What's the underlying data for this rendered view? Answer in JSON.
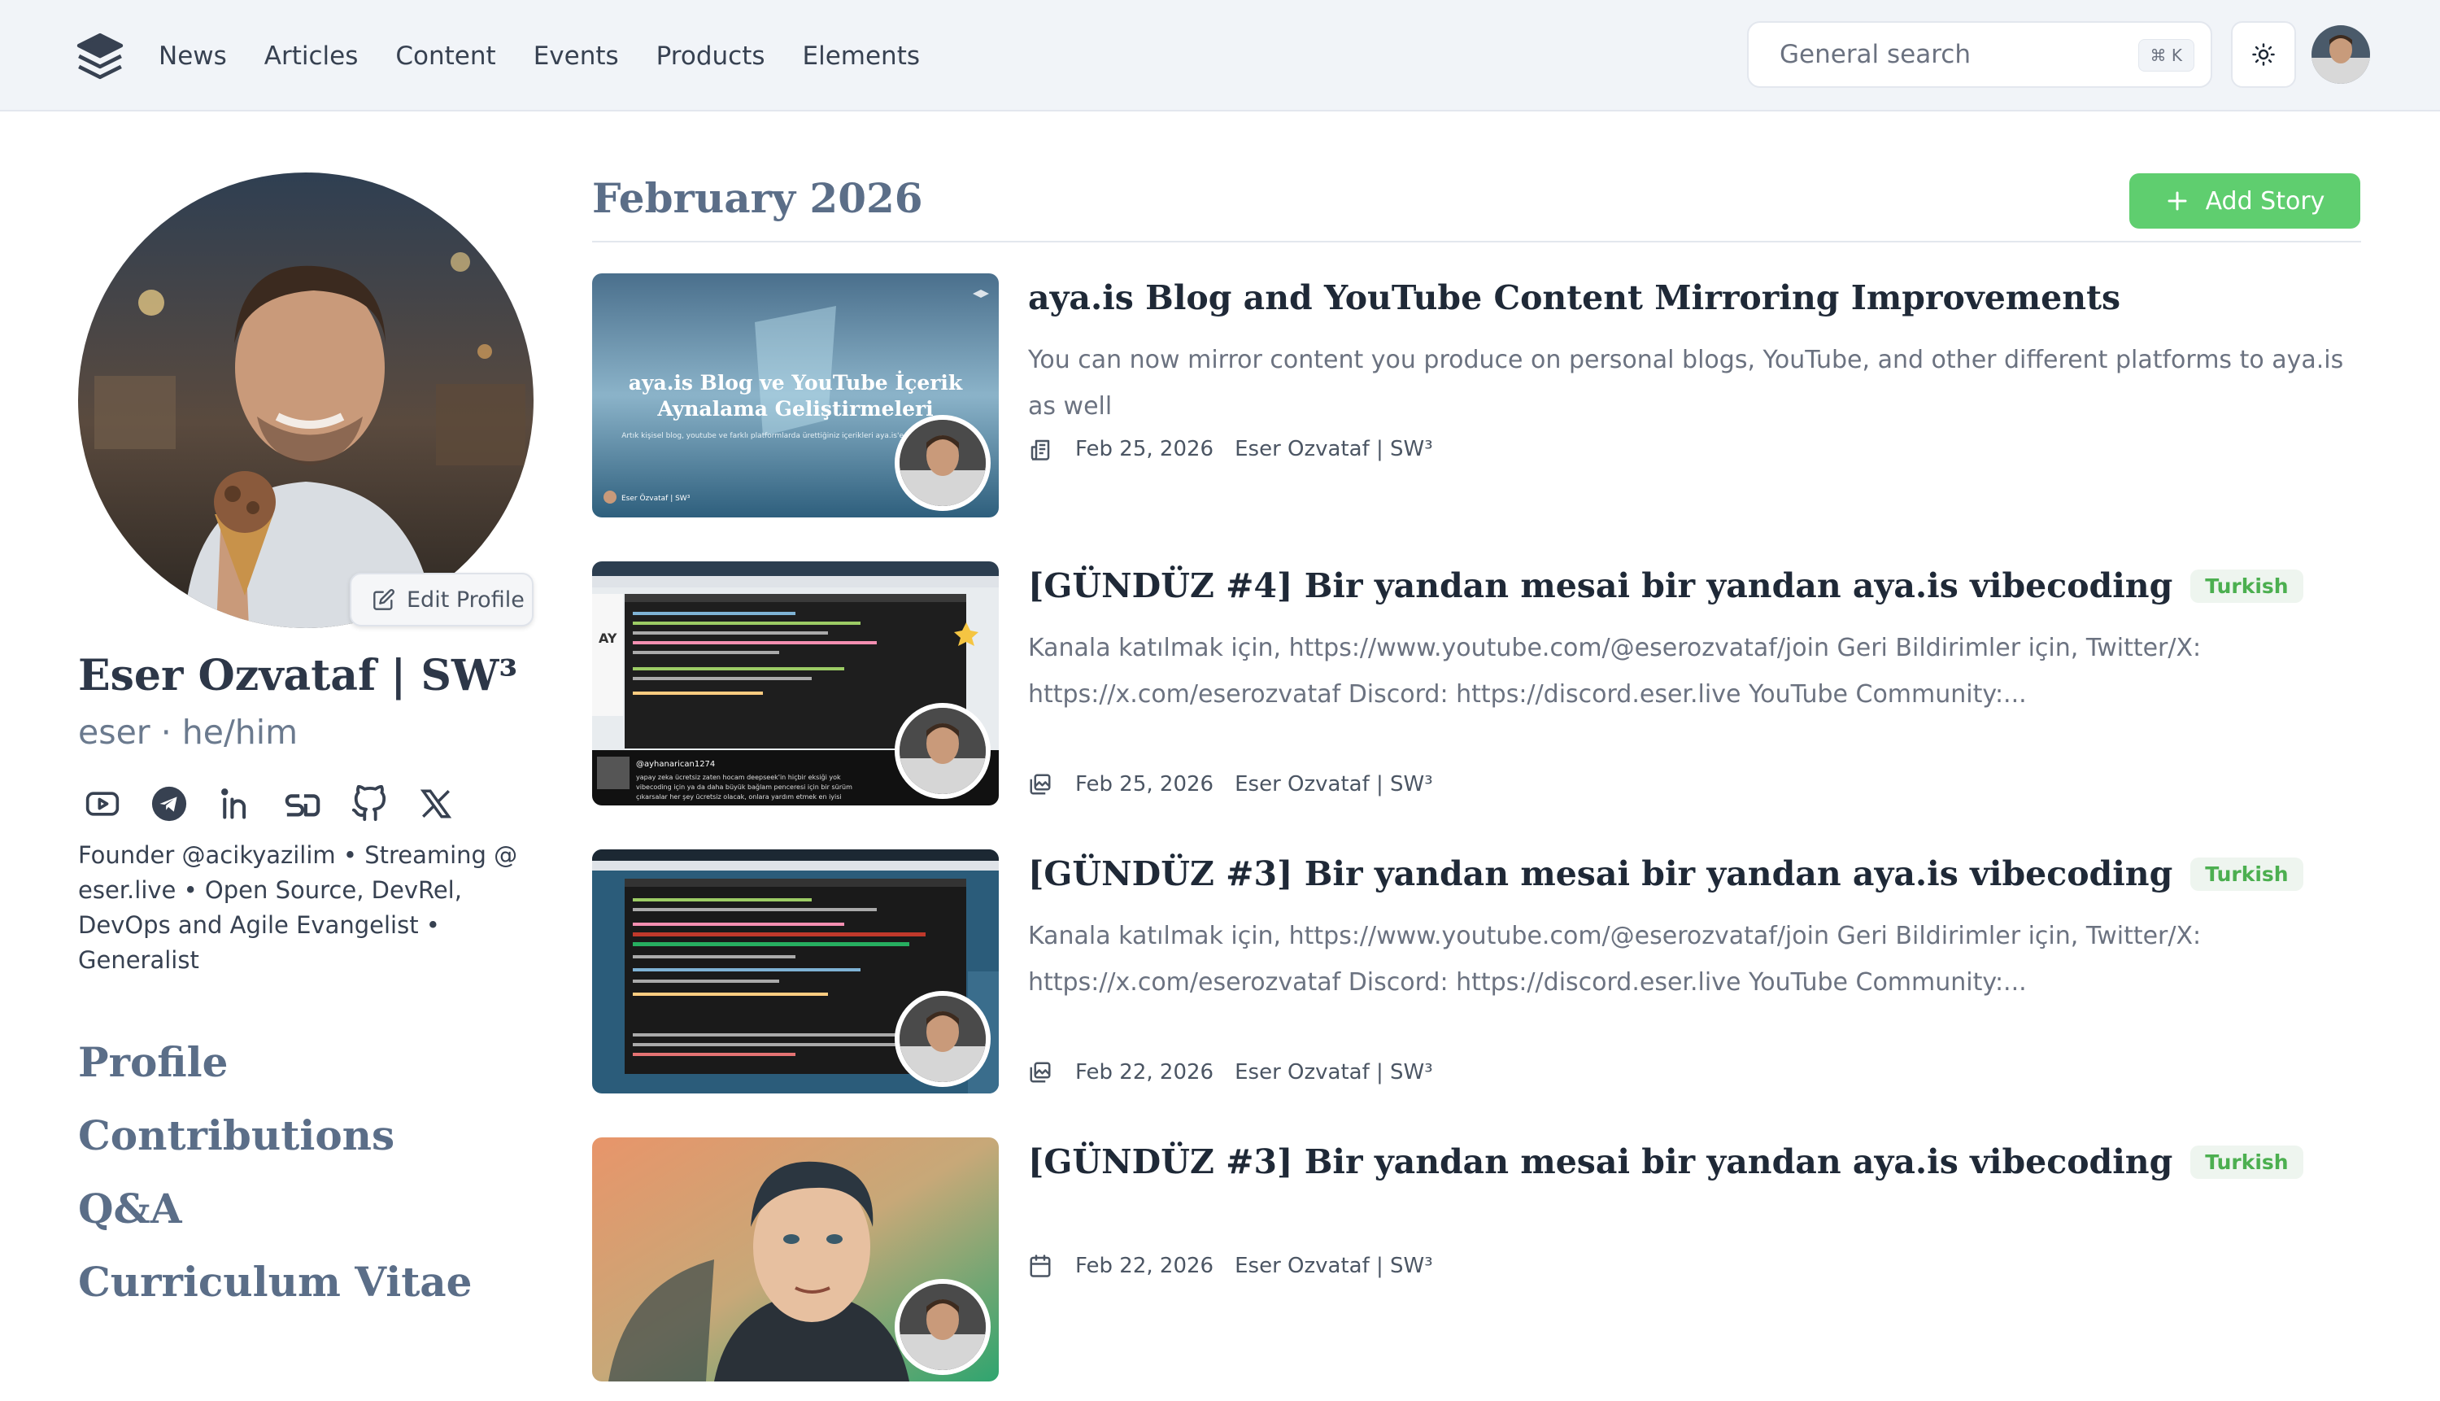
{
  "header": {
    "nav": [
      "News",
      "Articles",
      "Content",
      "Events",
      "Products",
      "Elements"
    ],
    "search": {
      "placeholder": "General search",
      "shortcut": "⌘ K"
    }
  },
  "profile": {
    "edit_label": "Edit Profile",
    "name": "Eser Ozvataf | SW³",
    "handle": "eser · he/him",
    "socials": [
      "youtube-icon",
      "telegram-icon",
      "linkedin-icon",
      "speakerdeck-icon",
      "github-icon",
      "x-icon"
    ],
    "bio": "Founder @acikyazilim • Streaming @ eser.live • Open Source, DevRel, DevOps and Agile Evangelist • Generalist",
    "nav": [
      "Profile",
      "Contributions",
      "Q&A",
      "Curriculum Vitae"
    ]
  },
  "main": {
    "month": "February 2026",
    "add_story": "Add Story",
    "thumb_text": {
      "title": "aya.is Blog ve YouTube İçerik Aynalama Geliştirmeleri",
      "subtitle": "Artık kişisel blog, youtube ve farklı platformlarda ürettiğiniz içerikleri aya.is'e aynalayabilirsiniz",
      "author": "Eser Özvataf | SW³",
      "chat_user": "@ayhanarican1274",
      "chat_msg": "yapay zeka ücretsiz zaten hocam deepseek'in hiçbir eksiği yok vibecoding için ya da daha büyük bağlam penceresi için bir sürüm çıkarsalar her şey ücretsiz olacak, onlara yardım etmek en iyisi"
    },
    "stories": [
      {
        "title": "aya.is Blog and YouTube Content Mirroring Improvements",
        "lang": "",
        "desc": "You can now mirror content you produce on personal blogs, YouTube, and other different platforms to aya.is as well",
        "date": "Feb 25, 2026",
        "author": "Eser Ozvataf | SW³",
        "icon": "article-icon"
      },
      {
        "title": "[GÜNDÜZ #4] Bir yandan mesai bir yandan aya.is vibecoding",
        "lang": "Turkish",
        "desc": "Kanala katılmak için, https://www.youtube.com/@eserozvataf/join Geri Bildirimler için, Twitter/X: https://x.com/eserozvataf Discord: https://discord.eser.live YouTube Community:...",
        "date": "Feb 25, 2026",
        "author": "Eser Ozvataf | SW³",
        "icon": "content-icon"
      },
      {
        "title": "[GÜNDÜZ #3] Bir yandan mesai bir yandan aya.is vibecoding",
        "lang": "Turkish",
        "desc": "Kanala katılmak için, https://www.youtube.com/@eserozvataf/join Geri Bildirimler için, Twitter/X: https://x.com/eserozvataf Discord: https://discord.eser.live YouTube Community:...",
        "date": "Feb 22, 2026",
        "author": "Eser Ozvataf | SW³",
        "icon": "content-icon"
      },
      {
        "title": "[GÜNDÜZ #3] Bir yandan mesai bir yandan aya.is vibecoding",
        "lang": "Turkish",
        "desc": "",
        "date": "Feb 22, 2026",
        "author": "Eser Ozvataf | SW³",
        "icon": "calendar-icon"
      }
    ]
  },
  "colors": {
    "accent": "#5fce6f",
    "heading": "#5b6e88",
    "badge_bg": "#eef5ef",
    "badge_fg": "#4caf50"
  }
}
